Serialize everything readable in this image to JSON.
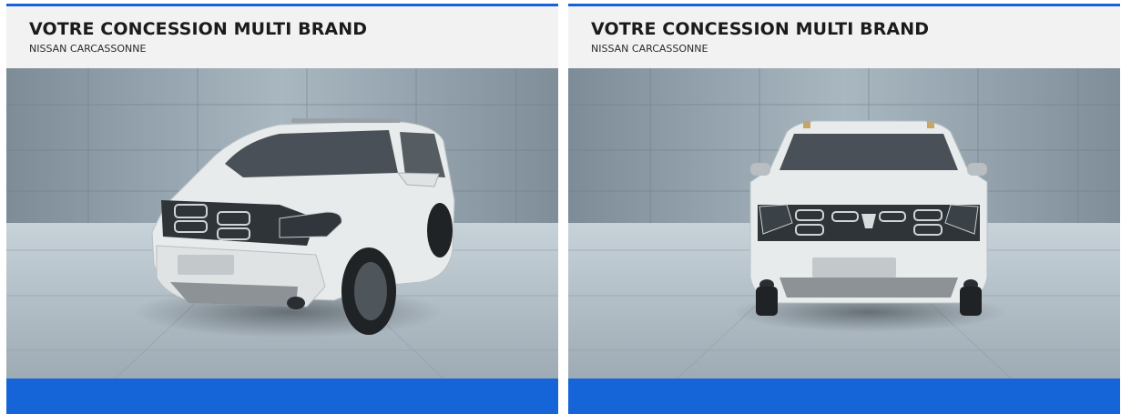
{
  "cards": [
    {
      "title": "VOTRE CONCESSION MULTI BRAND",
      "subtitle": "NISSAN CARCASSONNE",
      "photo": "car-three-quarter-front-view"
    },
    {
      "title": "VOTRE CONCESSION MULTI BRAND",
      "subtitle": "NISSAN CARCASSONNE",
      "photo": "car-front-view"
    }
  ],
  "colors": {
    "accent": "#1565d8",
    "header_bg": "#f2f2f2",
    "title_text": "#1b1b1b",
    "car_body": "#e9ecec"
  }
}
